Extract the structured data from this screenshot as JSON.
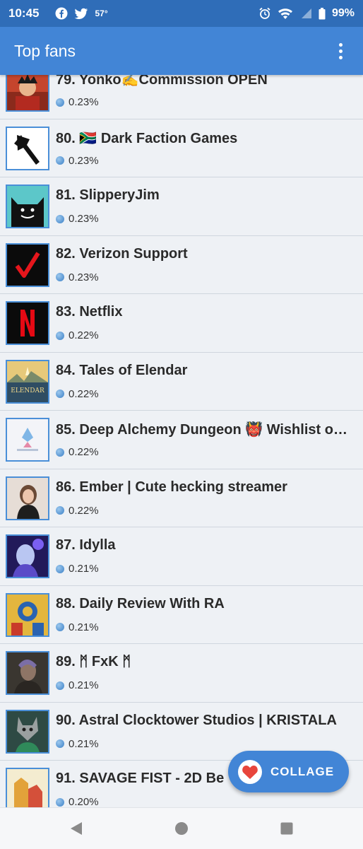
{
  "status_bar": {
    "time": "10:45",
    "temperature": "57°",
    "battery": "99%",
    "icons": [
      "facebook-icon",
      "twitter-icon",
      "alarm-icon",
      "wifi-icon",
      "signal-icon",
      "battery-icon"
    ]
  },
  "app_bar": {
    "title": "Top fans",
    "menu_icon": "more-vert-icon"
  },
  "fans": [
    {
      "name": "79. Yonko✍️Commission OPEN",
      "percent": "0.23%"
    },
    {
      "name": "80. 🇿🇦 Dark Faction Games",
      "percent": "0.23%"
    },
    {
      "name": "81. SlipperyJim",
      "percent": "0.23%"
    },
    {
      "name": "82. Verizon Support",
      "percent": "0.23%"
    },
    {
      "name": "83. Netflix",
      "percent": "0.22%"
    },
    {
      "name": "84. Tales of Elendar",
      "percent": "0.22%"
    },
    {
      "name": "85. Deep Alchemy Dungeon 👹 Wishlist o…",
      "percent": "0.22%"
    },
    {
      "name": "86. Ember | Cute hecking streamer",
      "percent": "0.22%"
    },
    {
      "name": "87. Idylla",
      "percent": "0.21%"
    },
    {
      "name": "88. Daily Review With RA",
      "percent": "0.21%"
    },
    {
      "name": "89. ᛗ FxK ᛗ",
      "percent": "0.21%"
    },
    {
      "name": "90. Astral Clocktower Studios | KRISTALA",
      "percent": "0.21%"
    },
    {
      "name": "91. SAVAGE FIST - 2D Be",
      "percent": "0.20%"
    }
  ],
  "avatar_texts": {
    "elendar": "ELENDAR"
  },
  "fab": {
    "label": "COLLAGE",
    "icon": "heart-icon"
  },
  "nav_bar": {
    "icons": [
      "back-icon",
      "home-icon",
      "recents-icon"
    ]
  },
  "colors": {
    "status_bar": "#2f6db8",
    "app_bar": "#4285d6",
    "accent_heart": "#e8453c"
  }
}
